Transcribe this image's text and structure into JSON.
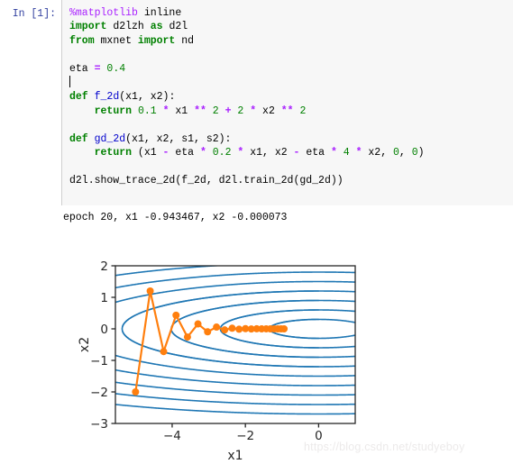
{
  "notebook": {
    "prompt_label": "In [1]:",
    "code_lines": [
      [
        {
          "t": "%matplotlib",
          "c": "mg"
        },
        {
          "t": " inline",
          "c": "pl"
        }
      ],
      [
        {
          "t": "import",
          "c": "k"
        },
        {
          "t": " d2lzh ",
          "c": "pl"
        },
        {
          "t": "as",
          "c": "k"
        },
        {
          "t": " d2l",
          "c": "pl"
        }
      ],
      [
        {
          "t": "from",
          "c": "k"
        },
        {
          "t": " mxnet ",
          "c": "pl"
        },
        {
          "t": "import",
          "c": "k"
        },
        {
          "t": " nd",
          "c": "pl"
        }
      ],
      [],
      [
        {
          "t": "eta ",
          "c": "pl"
        },
        {
          "t": "=",
          "c": "op"
        },
        {
          "t": " ",
          "c": "pl"
        },
        {
          "t": "0.4",
          "c": "n"
        }
      ],
      [
        {
          "t": "",
          "c": "caret"
        }
      ],
      [
        {
          "t": "def",
          "c": "k"
        },
        {
          "t": " ",
          "c": "pl"
        },
        {
          "t": "f_2d",
          "c": "fn"
        },
        {
          "t": "(x1, x2):",
          "c": "pl"
        }
      ],
      [
        {
          "t": "    ",
          "c": "pl"
        },
        {
          "t": "return",
          "c": "k"
        },
        {
          "t": " ",
          "c": "pl"
        },
        {
          "t": "0.1",
          "c": "n"
        },
        {
          "t": " ",
          "c": "pl"
        },
        {
          "t": "*",
          "c": "op"
        },
        {
          "t": " x1 ",
          "c": "pl"
        },
        {
          "t": "**",
          "c": "op"
        },
        {
          "t": " ",
          "c": "pl"
        },
        {
          "t": "2",
          "c": "n"
        },
        {
          "t": " ",
          "c": "pl"
        },
        {
          "t": "+",
          "c": "op"
        },
        {
          "t": " ",
          "c": "pl"
        },
        {
          "t": "2",
          "c": "n"
        },
        {
          "t": " ",
          "c": "pl"
        },
        {
          "t": "*",
          "c": "op"
        },
        {
          "t": " x2 ",
          "c": "pl"
        },
        {
          "t": "**",
          "c": "op"
        },
        {
          "t": " ",
          "c": "pl"
        },
        {
          "t": "2",
          "c": "n"
        }
      ],
      [],
      [
        {
          "t": "def",
          "c": "k"
        },
        {
          "t": " ",
          "c": "pl"
        },
        {
          "t": "gd_2d",
          "c": "fn"
        },
        {
          "t": "(x1, x2, s1, s2):",
          "c": "pl"
        }
      ],
      [
        {
          "t": "    ",
          "c": "pl"
        },
        {
          "t": "return",
          "c": "k"
        },
        {
          "t": " (x1 ",
          "c": "pl"
        },
        {
          "t": "-",
          "c": "op"
        },
        {
          "t": " eta ",
          "c": "pl"
        },
        {
          "t": "*",
          "c": "op"
        },
        {
          "t": " ",
          "c": "pl"
        },
        {
          "t": "0.2",
          "c": "n"
        },
        {
          "t": " ",
          "c": "pl"
        },
        {
          "t": "*",
          "c": "op"
        },
        {
          "t": " x1, x2 ",
          "c": "pl"
        },
        {
          "t": "-",
          "c": "op"
        },
        {
          "t": " eta ",
          "c": "pl"
        },
        {
          "t": "*",
          "c": "op"
        },
        {
          "t": " ",
          "c": "pl"
        },
        {
          "t": "4",
          "c": "n"
        },
        {
          "t": " ",
          "c": "pl"
        },
        {
          "t": "*",
          "c": "op"
        },
        {
          "t": " x2, ",
          "c": "pl"
        },
        {
          "t": "0",
          "c": "n"
        },
        {
          "t": ", ",
          "c": "pl"
        },
        {
          "t": "0",
          "c": "n"
        },
        {
          "t": ")",
          "c": "pl"
        }
      ],
      [],
      [
        {
          "t": "d2l.show_trace_2d(f_2d, d2l.train_2d(gd_2d))",
          "c": "pl"
        }
      ]
    ],
    "stdout": "epoch 20, x1 -0.943467, x2 -0.000073"
  },
  "watermark": "https://blog.csdn.net/studyeboy",
  "chart_data": {
    "type": "line",
    "title": "",
    "xlabel": "x1",
    "ylabel": "x2",
    "xlim": [
      -5.55,
      1.0
    ],
    "ylim": [
      -3.0,
      2.0
    ],
    "xticks": [
      -4,
      -2,
      0
    ],
    "xticklabels": [
      "−4",
      "−2",
      "0"
    ],
    "yticks": [
      -3,
      -2,
      -1,
      0,
      1,
      2
    ],
    "yticklabels": [
      "−3",
      "−2",
      "−1",
      "0",
      "1",
      "2"
    ],
    "grid": false,
    "legend": null,
    "colors": {
      "trajectory": "#ff7f0e",
      "contour": "#1f77b4",
      "axes": "#262626",
      "background": "#ffffff"
    },
    "series": [
      {
        "name": "gradient descent trajectory",
        "color": "#ff7f0e",
        "marker": "o",
        "x": [
          -5.0,
          -4.6,
          -4.232,
          -3.89344,
          -3.5819648,
          -3.295407616,
          -3.0317750067,
          -2.7892330062,
          -2.5660943657,
          -2.3608068164,
          -2.1719422711,
          -1.9981868894,
          -1.8383319382,
          -1.6912653832,
          -1.5559641525,
          -1.4314870203,
          -1.3169680587,
          -1.211610614,
          -1.1146817649,
          -1.0255072237,
          -0.9434666458
        ],
        "y": [
          -2.0,
          1.2,
          -0.72,
          0.432,
          -0.2592,
          0.15552,
          -0.093312,
          0.0559872,
          -0.03359232,
          0.020155392,
          -0.0120932352,
          0.00725594112,
          -0.0043535647,
          0.0026121388,
          -0.0015672833,
          0.00094037,
          -0.0005642,
          0.00033852,
          -0.00020311,
          0.00012187,
          -7.31e-05
        ]
      }
    ],
    "contour": {
      "function": "0.1*x1**2 + 2*x2**2",
      "color": "#1f77b4",
      "levels": [
        0.18,
        0.72,
        1.62,
        2.88,
        4.5,
        6.48,
        8.82,
        11.52,
        14.58
      ]
    }
  }
}
